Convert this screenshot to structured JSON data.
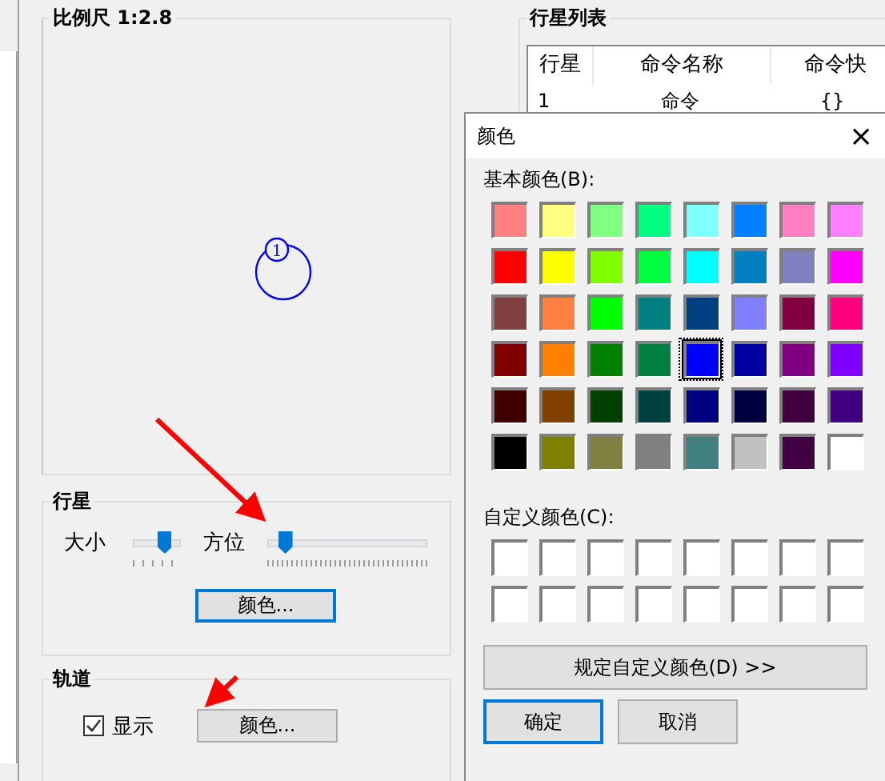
{
  "scale_group": {
    "title": "比例尺 1:2.8",
    "planet_marker": "1"
  },
  "planet_group": {
    "title": "行星",
    "sliders": [
      {
        "label": "大小",
        "level": 0.66
      },
      {
        "label": "方位",
        "level": 0.1
      }
    ],
    "color_button": {
      "label": "颜色...",
      "focused": true
    }
  },
  "orbit_group": {
    "title": "轨道",
    "show_checkbox": {
      "label": "显示",
      "checked": true
    },
    "color_button": {
      "label": "颜色...",
      "focused": false
    }
  },
  "planet_list": {
    "title": "行星列表",
    "columns": [
      "行星",
      "命令名称",
      "命令快"
    ],
    "rows": [
      [
        "1",
        "命令",
        "{}"
      ]
    ]
  },
  "color_dialog": {
    "title": "颜色",
    "close": "×",
    "basic_label": "基本颜色(B):",
    "basic_colors": [
      {
        "color": "#ff8080",
        "selected": false
      },
      {
        "color": "#ffff80",
        "selected": false
      },
      {
        "color": "#80ff80",
        "selected": false
      },
      {
        "color": "#00ff80",
        "selected": false
      },
      {
        "color": "#80ffff",
        "selected": false
      },
      {
        "color": "#0080ff",
        "selected": false
      },
      {
        "color": "#ff80c0",
        "selected": false
      },
      {
        "color": "#ff80ff",
        "selected": false
      },
      {
        "color": "#ff0000",
        "selected": false
      },
      {
        "color": "#ffff00",
        "selected": false
      },
      {
        "color": "#80ff00",
        "selected": false
      },
      {
        "color": "#00ff40",
        "selected": false
      },
      {
        "color": "#00ffff",
        "selected": false
      },
      {
        "color": "#0080c0",
        "selected": false
      },
      {
        "color": "#8080c0",
        "selected": false
      },
      {
        "color": "#ff00ff",
        "selected": false
      },
      {
        "color": "#804040",
        "selected": false
      },
      {
        "color": "#ff8040",
        "selected": false
      },
      {
        "color": "#00ff00",
        "selected": false
      },
      {
        "color": "#008080",
        "selected": false
      },
      {
        "color": "#004080",
        "selected": false
      },
      {
        "color": "#8080ff",
        "selected": false
      },
      {
        "color": "#800040",
        "selected": false
      },
      {
        "color": "#ff0080",
        "selected": false
      },
      {
        "color": "#800000",
        "selected": false
      },
      {
        "color": "#ff8000",
        "selected": false
      },
      {
        "color": "#008000",
        "selected": false
      },
      {
        "color": "#008040",
        "selected": false
      },
      {
        "color": "#0000ff",
        "selected": true
      },
      {
        "color": "#0000a0",
        "selected": false
      },
      {
        "color": "#800080",
        "selected": false
      },
      {
        "color": "#8000ff",
        "selected": false
      },
      {
        "color": "#400000",
        "selected": false
      },
      {
        "color": "#804000",
        "selected": false
      },
      {
        "color": "#004000",
        "selected": false
      },
      {
        "color": "#004040",
        "selected": false
      },
      {
        "color": "#000080",
        "selected": false
      },
      {
        "color": "#000040",
        "selected": false
      },
      {
        "color": "#400040",
        "selected": false
      },
      {
        "color": "#400080",
        "selected": false
      },
      {
        "color": "#000000",
        "selected": false
      },
      {
        "color": "#808000",
        "selected": false
      },
      {
        "color": "#808040",
        "selected": false
      },
      {
        "color": "#808080",
        "selected": false
      },
      {
        "color": "#408080",
        "selected": false
      },
      {
        "color": "#c0c0c0",
        "selected": false
      },
      {
        "color": "#400041",
        "selected": false
      },
      {
        "color": "#ffffff",
        "selected": false
      }
    ],
    "custom_label": "自定义颜色(C):",
    "custom_colors": [
      {
        "color": "#ffffff"
      },
      {
        "color": "#ffffff"
      },
      {
        "color": "#ffffff"
      },
      {
        "color": "#ffffff"
      },
      {
        "color": "#ffffff"
      },
      {
        "color": "#ffffff"
      },
      {
        "color": "#ffffff"
      },
      {
        "color": "#ffffff"
      },
      {
        "color": "#ffffff"
      },
      {
        "color": "#ffffff"
      },
      {
        "color": "#ffffff"
      },
      {
        "color": "#ffffff"
      },
      {
        "color": "#ffffff"
      },
      {
        "color": "#ffffff"
      },
      {
        "color": "#ffffff"
      },
      {
        "color": "#ffffff"
      }
    ],
    "define_button": "规定自定义颜色(D) >>",
    "buttons": [
      {
        "label": "确定",
        "focused": true
      },
      {
        "label": "取消",
        "focused": false
      }
    ]
  }
}
